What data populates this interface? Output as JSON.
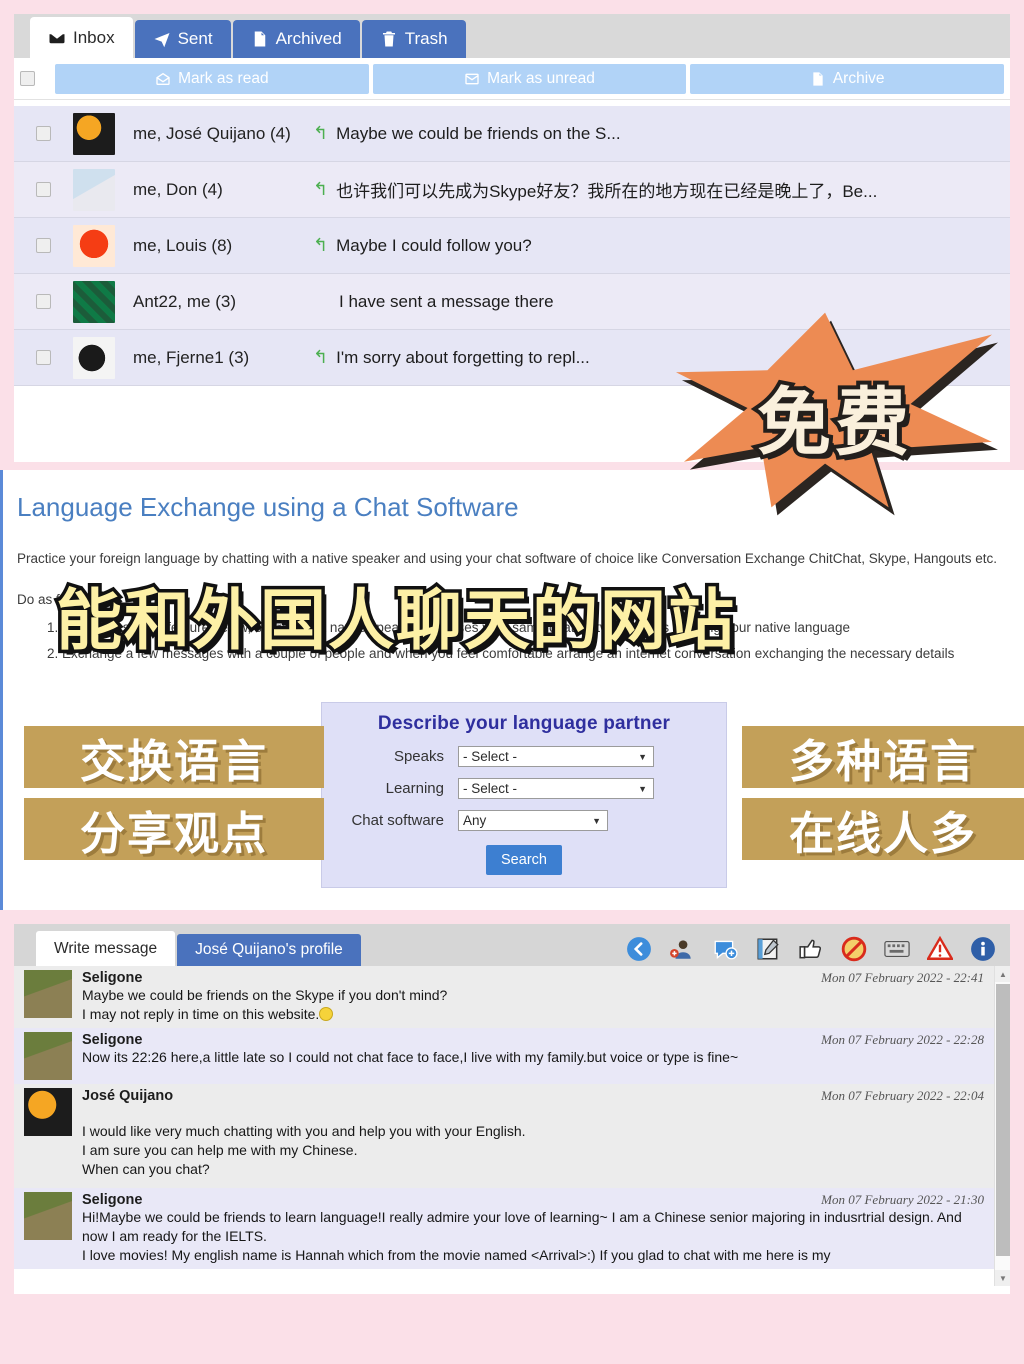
{
  "inbox": {
    "tabs": [
      {
        "label": "Inbox",
        "icon": "inbox-icon",
        "active": true
      },
      {
        "label": "Sent",
        "icon": "paper-plane-icon",
        "active": false
      },
      {
        "label": "Archived",
        "icon": "archive-file-icon",
        "active": false
      },
      {
        "label": "Trash",
        "icon": "trash-icon",
        "active": false
      }
    ],
    "bulk_actions": [
      {
        "label": "Mark as read",
        "icon": "envelope-open-icon"
      },
      {
        "label": "Mark as unread",
        "icon": "envelope-closed-icon"
      },
      {
        "label": "Archive",
        "icon": "archive-file-icon"
      }
    ],
    "rows": [
      {
        "who": "me, José Quijano  (4)",
        "preview": "Maybe we could be friends on the S...",
        "replied": true,
        "avatar": "toucan-avatar"
      },
      {
        "who": "me, Don  (4)",
        "preview": "也许我们可以先成为Skype好友？我所在的地方现在已经是晚上了，Be...",
        "replied": true,
        "avatar": "kite-avatar"
      },
      {
        "who": "me, Louis  (8)",
        "preview": "Maybe I could follow you?",
        "replied": true,
        "avatar": "coral-avatar"
      },
      {
        "who": "Ant22, me  (3)",
        "preview": "I have sent a message there",
        "replied": false,
        "avatar": "pool-balls-avatar"
      },
      {
        "who": "me, Fjerne1  (3)",
        "preview": "I'm sorry about forgetting to repl...",
        "replied": true,
        "avatar": "dumbbell-avatar"
      }
    ]
  },
  "middle": {
    "title": "Language Exchange using a Chat Software",
    "paragraph": "Practice your foreign language by chatting with a native speaker and using your chat software of choice like Conversation Exchange ChitChat, Skype, Hangouts etc.",
    "do_as_follows": "Do as follows:",
    "steps": [
      "1. Using the search feature below, search for a native speaker who uses your same chat software and is learning your native language",
      "2. Exchange a few messages with a couple of people and when you feel comfortable arrange an internet conversation exchanging the necessary details"
    ],
    "search_form": {
      "title": "Describe your language partner",
      "fields": [
        {
          "label": "Speaks",
          "value": "- Select -"
        },
        {
          "label": "Learning",
          "value": "- Select -"
        },
        {
          "label": "Chat software",
          "value": "Any"
        }
      ],
      "button": "Search"
    }
  },
  "overlays": {
    "starburst": "免费",
    "headline": "能和外国人聊天的网站",
    "left_top": "交换语言",
    "left_bottom": "分享观点",
    "right_top": "多种语言",
    "right_bottom": "在线人多"
  },
  "chat": {
    "tabs": [
      {
        "label": "Write message",
        "active": true
      },
      {
        "label": "José Quijano's profile",
        "active": false
      }
    ],
    "toolbar_icons": [
      "back-arrow-icon",
      "add-friend-icon",
      "new-chat-icon",
      "notepad-edit-icon",
      "thumbs-up-icon",
      "block-user-icon",
      "keyboard-icon",
      "report-warning-icon",
      "info-icon"
    ],
    "messages": [
      {
        "author": "Seligone",
        "time": "Mon 07 February 2022 - 22:41",
        "avatar": "meerkat-avatar",
        "lines": [
          "Maybe we could be friends on the Skype if you don't mind?",
          "I may not reply in time on this website."
        ],
        "has_emoji": true
      },
      {
        "author": "Seligone",
        "time": "Mon 07 February 2022 - 22:28",
        "avatar": "meerkat-avatar",
        "lines": [
          "Now its 22:26 here,a little late so I could not chat face to face,I live with my family.but voice or type is fine~"
        ],
        "has_emoji": false
      },
      {
        "author": "José Quijano",
        "time": "Mon 07 February 2022 - 22:04",
        "avatar": "toucan-avatar",
        "lines": [
          "I would like very much chatting with you and help you with your English.",
          "I am sure you can help me with my Chinese.",
          "When can you chat?"
        ],
        "has_emoji": false
      },
      {
        "author": "Seligone",
        "time": "Mon 07 February 2022 - 21:30",
        "avatar": "meerkat-avatar",
        "lines": [
          "Hi!Maybe we could be friends to learn language!I really admire your love of learning~ I am a Chinese senior majoring in indusrtrial design. And now I am ready for the IELTS.",
          "I love movies! My english name is Hannah which from the movie named <Arrival>:) If you glad to chat with me here is my"
        ],
        "has_emoji": false
      }
    ]
  },
  "colors": {
    "page_border": "#fbe0e8",
    "tab_blue": "#4a72bd",
    "bulk_blue": "#b1d3f7",
    "row_lavender": "#e6e6f5",
    "heading_blue": "#4a7fc1",
    "form_bg": "#dfe0f7",
    "gold": "#c3a059",
    "orange_star": "#ed8b53",
    "yellow_text": "#fdf0a6"
  }
}
